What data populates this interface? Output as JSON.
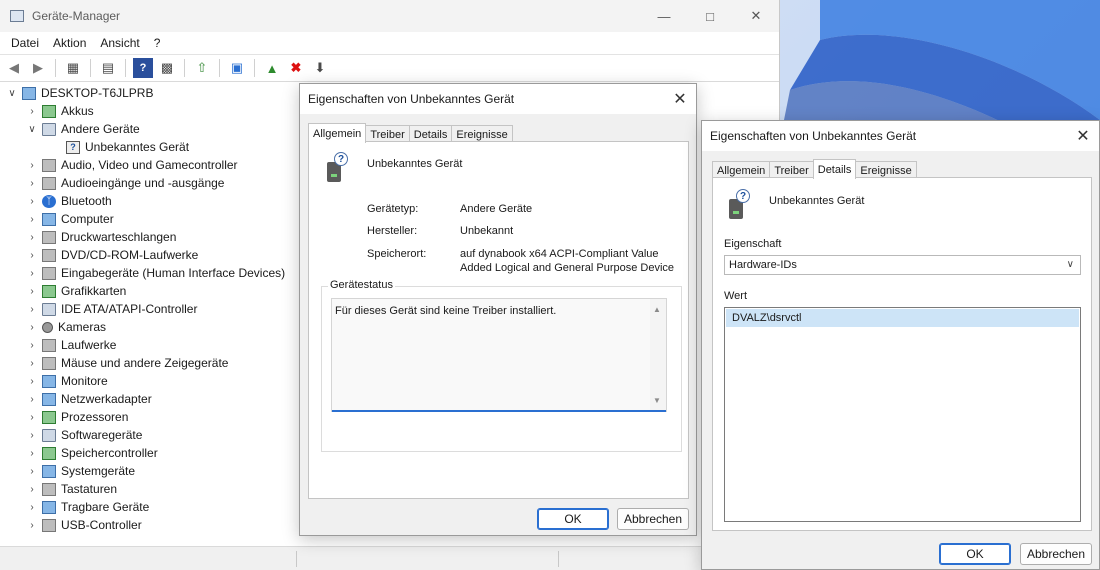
{
  "dm": {
    "title": "Geräte-Manager",
    "menu": [
      "Datei",
      "Aktion",
      "Ansicht",
      "?"
    ],
    "root": "DESKTOP-T6JLPRB",
    "tree": [
      {
        "label": "Akkus",
        "icon": "battery-icon",
        "expanded": false
      },
      {
        "label": "Andere Geräte",
        "icon": "other-devices-icon",
        "expanded": true
      },
      {
        "label": "Unbekanntes Gerät",
        "icon": "unknown-device-icon",
        "child": true
      },
      {
        "label": "Audio, Video und Gamecontroller",
        "icon": "speaker-icon",
        "expanded": false
      },
      {
        "label": "Audioeingänge und -ausgänge",
        "icon": "speaker-icon",
        "expanded": false
      },
      {
        "label": "Bluetooth",
        "icon": "bluetooth-icon",
        "expanded": false
      },
      {
        "label": "Computer",
        "icon": "computer-icon",
        "expanded": false
      },
      {
        "label": "Druckwarteschlangen",
        "icon": "printer-icon",
        "expanded": false
      },
      {
        "label": "DVD/CD-ROM-Laufwerke",
        "icon": "dvd-drive-icon",
        "expanded": false
      },
      {
        "label": "Eingabegeräte (Human Interface Devices)",
        "icon": "hid-icon",
        "expanded": false
      },
      {
        "label": "Grafikkarten",
        "icon": "display-adapter-icon",
        "expanded": false
      },
      {
        "label": "IDE ATA/ATAPI-Controller",
        "icon": "ide-controller-icon",
        "expanded": false
      },
      {
        "label": "Kameras",
        "icon": "camera-icon",
        "expanded": false
      },
      {
        "label": "Laufwerke",
        "icon": "disk-drive-icon",
        "expanded": false
      },
      {
        "label": "Mäuse und andere Zeigegeräte",
        "icon": "mouse-icon",
        "expanded": false
      },
      {
        "label": "Monitore",
        "icon": "monitor-icon",
        "expanded": false
      },
      {
        "label": "Netzwerkadapter",
        "icon": "network-adapter-icon",
        "expanded": false
      },
      {
        "label": "Prozessoren",
        "icon": "processor-icon",
        "expanded": false
      },
      {
        "label": "Softwaregeräte",
        "icon": "software-device-icon",
        "expanded": false
      },
      {
        "label": "Speichercontroller",
        "icon": "storage-controller-icon",
        "expanded": false
      },
      {
        "label": "Systemgeräte",
        "icon": "system-device-icon",
        "expanded": false
      },
      {
        "label": "Tastaturen",
        "icon": "keyboard-icon",
        "expanded": false
      },
      {
        "label": "Tragbare Geräte",
        "icon": "portable-device-icon",
        "expanded": false
      },
      {
        "label": "USB-Controller",
        "icon": "usb-icon",
        "expanded": false
      }
    ]
  },
  "dlg1": {
    "title": "Eigenschaften von Unbekanntes Gerät",
    "tabs": [
      "Allgemein",
      "Treiber",
      "Details",
      "Ereignisse"
    ],
    "device_name": "Unbekanntes Gerät",
    "type_label": "Gerätetyp:",
    "type_value": "Andere Geräte",
    "mfr_label": "Hersteller:",
    "mfr_value": "Unbekannt",
    "loc_label": "Speicherort:",
    "loc_value_1": "auf dynabook x64 ACPI-Compliant Value",
    "loc_value_2": "Added Logical and General Purpose Device",
    "status_legend": "Gerätestatus",
    "status_text": "Für dieses Gerät sind keine Treiber installiert.",
    "ok": "OK",
    "cancel": "Abbrechen"
  },
  "dlg2": {
    "title": "Eigenschaften von Unbekanntes Gerät",
    "tabs": [
      "Allgemein",
      "Treiber",
      "Details",
      "Ereignisse"
    ],
    "device_name": "Unbekanntes Gerät",
    "property_label": "Eigenschaft",
    "property_value": "Hardware-IDs",
    "value_label": "Wert",
    "value_item": "DVALZ\\dsrvctl",
    "ok": "OK",
    "cancel": "Abbrechen"
  },
  "colors": {
    "accent": "#2a6fd1",
    "selection": "#cde4f7"
  }
}
